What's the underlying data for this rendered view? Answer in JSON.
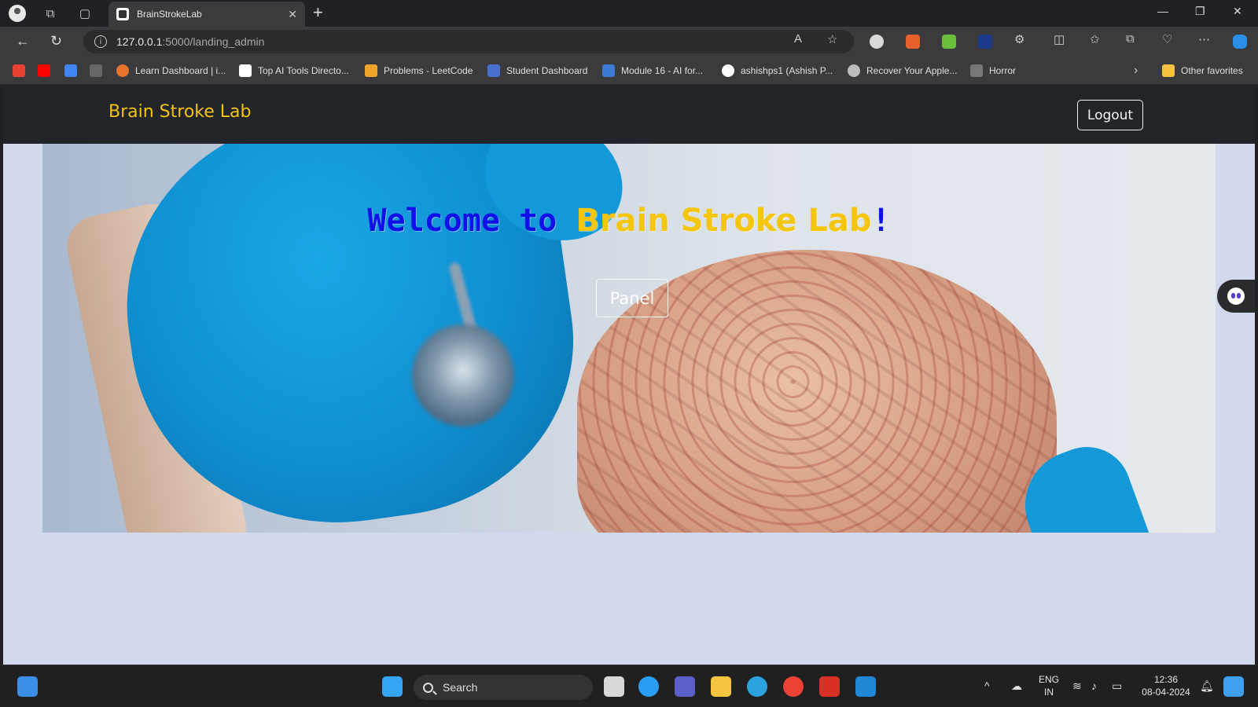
{
  "browser": {
    "tab_title": "BrainStrokeLab",
    "tab_close": "✕",
    "new_tab": "+",
    "url_host": "127.0.0.1",
    "url_path": ":5000/landing_admin",
    "bookmarks": [
      {
        "label": "Learn Dashboard | i...",
        "icon_color": "#e8732c"
      },
      {
        "label": "Top AI Tools Directo...",
        "icon_color": "#ffffff"
      },
      {
        "label": "Problems - LeetCode",
        "icon_color": "#f0a42a"
      },
      {
        "label": "Student Dashboard",
        "icon_color": "#4a6fd0"
      },
      {
        "label": "Module 16 - AI for...",
        "icon_color": "#3a7bd5"
      },
      {
        "label": "ashishps1 (Ashish P...",
        "icon_color": "#ffffff"
      },
      {
        "label": "Recover Your Apple...",
        "icon_color": "#bbbbbb"
      },
      {
        "label": "Horror",
        "icon_color": "#777777"
      }
    ],
    "other_favorites": "Other favorites"
  },
  "page": {
    "brand": "Brain Stroke Lab",
    "logout_label": "Logout",
    "welcome_part1": "Welcome to ",
    "welcome_part2": "Brain Stroke Lab",
    "welcome_part3": "!",
    "panel_label": "Panel",
    "colors": {
      "brand": "#f2c311",
      "welcome_blue": "#1010e8",
      "navbar_bg": "#212529",
      "page_bg": "#d2d9ec"
    }
  },
  "taskbar": {
    "search_label": "Search",
    "lang_line1": "ENG",
    "lang_line2": "IN",
    "time": "12:36",
    "date": "08-04-2024"
  }
}
